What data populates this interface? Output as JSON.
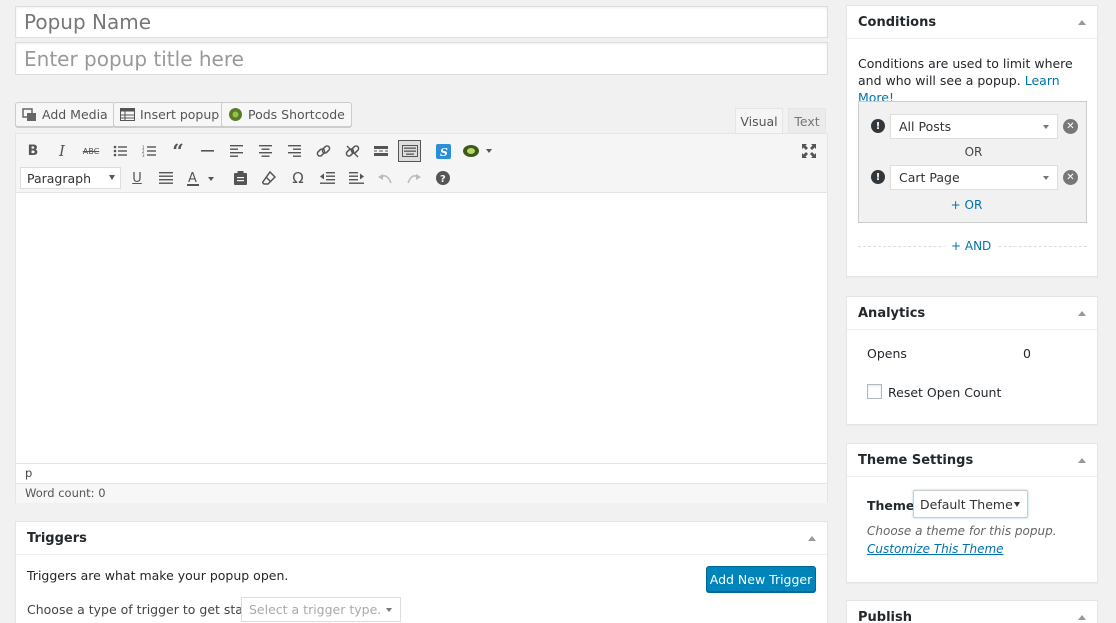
{
  "title_fields": {
    "name_placeholder": "Popup Name",
    "title_placeholder": "Enter popup title here"
  },
  "media_buttons": {
    "add_media": "Add Media",
    "insert_popup": "Insert popup",
    "pods_shortcode": "Pods Shortcode"
  },
  "editor": {
    "tab_visual": "Visual",
    "tab_text": "Text",
    "format_value": "Paragraph",
    "path": "p",
    "word_count": "Word count: 0"
  },
  "triggers": {
    "title": "Triggers",
    "description": "Triggers are what make your popup open.",
    "add_button": "Add New Trigger",
    "choose_label": "Choose a type of trigger to get started.",
    "select_placeholder": "Select a trigger type."
  },
  "conditions": {
    "title": "Conditions",
    "intro": "Conditions are used to limit where and who will see a popup.",
    "learn_more": "Learn More!",
    "rows": [
      "All Posts",
      "Cart Page"
    ],
    "or_label": "OR",
    "add_or": "+ OR",
    "add_and": "+ AND"
  },
  "analytics": {
    "title": "Analytics",
    "opens_label": "Opens",
    "opens_value": "0",
    "reset_label": "Reset Open Count"
  },
  "theme_settings": {
    "title": "Theme Settings",
    "theme_label": "Theme",
    "theme_value": "Default Theme",
    "description": "Choose a theme for this popup.",
    "customize_link": "Customize This Theme"
  },
  "publish": {
    "title": "Publish"
  },
  "colors": {
    "primary_button": "#0085ba",
    "link": "#0073aa",
    "background": "#f1f1f1"
  }
}
